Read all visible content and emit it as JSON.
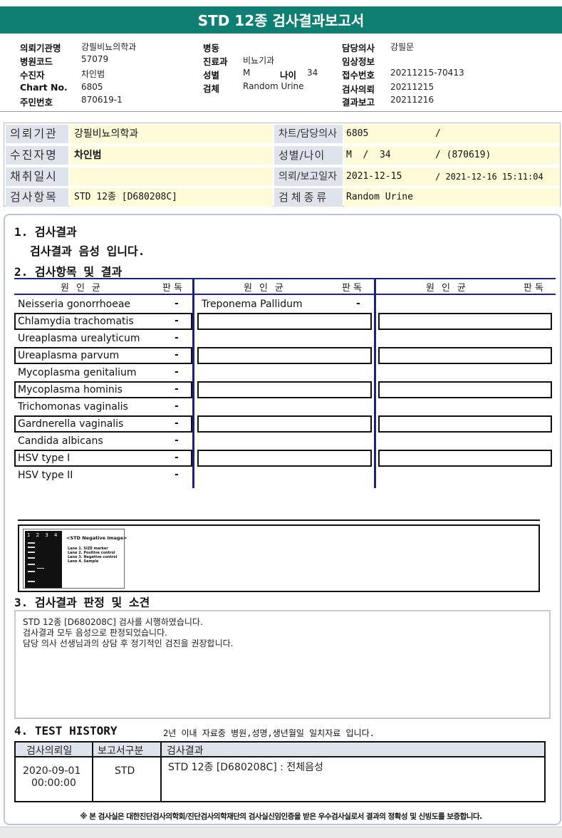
{
  "title": "STD 12종 검사결과보고서",
  "header": {
    "col1": [
      {
        "label": "의뢰기관명",
        "value": "강필비뇨의학과"
      },
      {
        "label": "병원코드",
        "value": "57079"
      },
      {
        "label": "수진자",
        "value": "차인범"
      },
      {
        "label": "Chart No.",
        "value": "6805"
      },
      {
        "label": "주민번호",
        "value": "870619-1"
      }
    ],
    "col2": [
      {
        "label": "병동",
        "value": ""
      },
      {
        "label": "진료과",
        "value": "비뇨기과"
      },
      {
        "label": "성별",
        "value": "M"
      },
      {
        "label": "검체",
        "value": "Random Urine"
      }
    ],
    "age": {
      "label": "나이",
      "value": "34"
    },
    "col3": [
      {
        "label": "담당의사",
        "value": "강필문"
      },
      {
        "label": "임상정보",
        "value": ""
      },
      {
        "label": "접수번호",
        "value": "20211215-70413"
      },
      {
        "label": "검사의뢰",
        "value": "20211215"
      },
      {
        "label": "결과보고",
        "value": "20211216"
      }
    ]
  },
  "info": {
    "rows": [
      {
        "label": "의뢰기관",
        "value": "강필비뇨의학과",
        "label2": "차트/담당의사",
        "v1": "6805",
        "v2": "/"
      },
      {
        "label": "수진자명",
        "value": "차인범",
        "label2": "성별/나이",
        "v1": "M  /  34",
        "v2": "/ (870619)"
      },
      {
        "label": "채취일시",
        "value": "",
        "label2": "의뢰/보고일자",
        "v1": "2021-12-15",
        "v2": "/ 2021-12-16 15:11:04"
      },
      {
        "label": "검사항목",
        "value": "STD 12종 [D680208C]",
        "label2": "검체종류",
        "v1": "Random Urine",
        "v2": ""
      }
    ]
  },
  "section1": {
    "title": "1. 검사결과",
    "summary": "검사결과 음성 입니다."
  },
  "section2": {
    "title": "2. 검사항목 및 결과",
    "col_header": "원인균",
    "judge_header": "판독",
    "col1": [
      {
        "name": "Neisseria gonorrhoeae",
        "result": "-"
      },
      {
        "name": "Chlamydia trachomatis",
        "result": "-"
      },
      {
        "name": "Ureaplasma urealyticum",
        "result": "-"
      },
      {
        "name": "Ureaplasma parvum",
        "result": "-"
      },
      {
        "name": "Mycoplasma genitalium",
        "result": "-"
      },
      {
        "name": "Mycoplasma hominis",
        "result": "-"
      },
      {
        "name": "Trichomonas vaginalis",
        "result": "-"
      },
      {
        "name": "Gardnerella vaginalis",
        "result": "-"
      },
      {
        "name": "Candida albicans",
        "result": "-"
      },
      {
        "name": "HSV type I",
        "result": "-"
      },
      {
        "name": "HSV type II",
        "result": "-"
      }
    ],
    "col2": [
      {
        "name": "Treponema Pallidum",
        "result": "-"
      }
    ]
  },
  "gel": {
    "lane_numbers": "1 2 3 4",
    "title": "<STD Negative Image>",
    "lanes": [
      "Lane 1. SIZE marker",
      "Lane 2. Positive control",
      "Lane 3. Negative control",
      "Lane 4. Sample"
    ]
  },
  "section3": {
    "title": "3. 검사결과 판정 및 소견",
    "lines": [
      "STD 12종 [D680208C] 검사를 시행하였습니다.",
      "검사결과 모두 음성으로 판정되었습니다.",
      "담당 의사 선생님과의 상담 후 정기적인 검진을 권장합니다."
    ]
  },
  "section4": {
    "title": "4. TEST HISTORY",
    "note": "2년 이내 자료중 병원,성명,생년월일 일치자료 입니다.",
    "headers": [
      "검사의뢰일",
      "보고서구분",
      "검사결과"
    ],
    "row": {
      "date": "2020-09-01",
      "time": "00:00:00",
      "type": "STD",
      "result": "STD 12종 [D680208C] : 전체음성"
    }
  },
  "footer": "※ 본 검사실은 대한진단검사의학회/진단검사의학재단의 검사실신임인증을 받은 우수검사실로서 결과의 정확성 및 신빙도를 보증합니다."
}
